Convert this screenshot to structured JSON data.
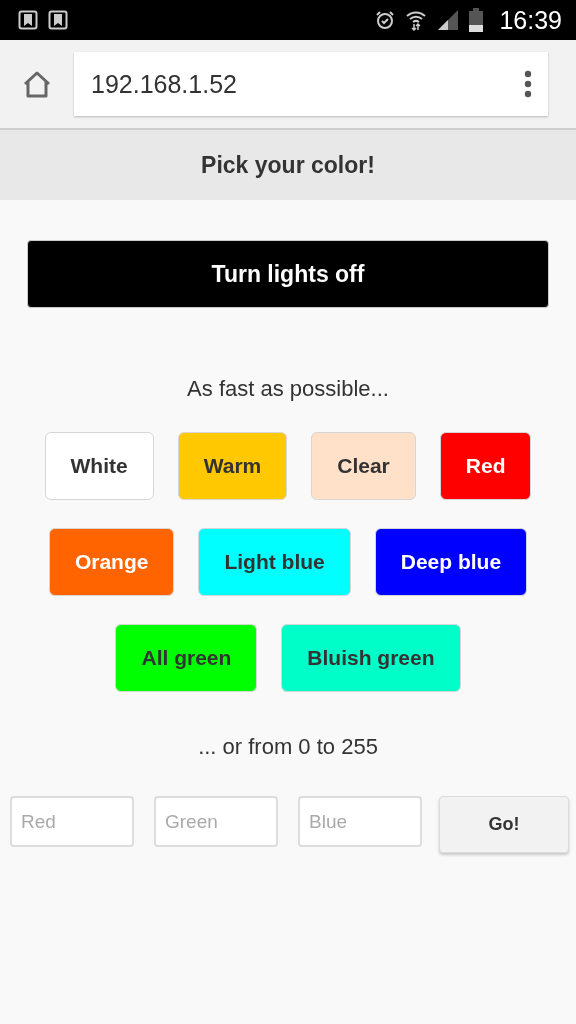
{
  "status_bar": {
    "time": "16:39"
  },
  "browser": {
    "url": "192.168.1.52"
  },
  "header": {
    "title": "Pick your color!"
  },
  "lights_button": {
    "label": "Turn lights off"
  },
  "presets": {
    "caption": "As fast as possible...",
    "buttons": [
      {
        "label": "White",
        "color": "#ffffff"
      },
      {
        "label": "Warm",
        "color": "#ffc800"
      },
      {
        "label": "Clear",
        "color": "#ffe0c8"
      },
      {
        "label": "Red",
        "color": "#ff0000"
      },
      {
        "label": "Orange",
        "color": "#ff6400"
      },
      {
        "label": "Light blue",
        "color": "#00ffff"
      },
      {
        "label": "Deep blue",
        "color": "#0000ff"
      },
      {
        "label": "All green",
        "color": "#00ff00"
      },
      {
        "label": "Bluish green",
        "color": "#00ffc8"
      }
    ]
  },
  "custom": {
    "caption": "... or from 0 to 255",
    "fields": [
      {
        "placeholder": "Red"
      },
      {
        "placeholder": "Green"
      },
      {
        "placeholder": "Blue"
      }
    ],
    "submit": "Go!"
  }
}
